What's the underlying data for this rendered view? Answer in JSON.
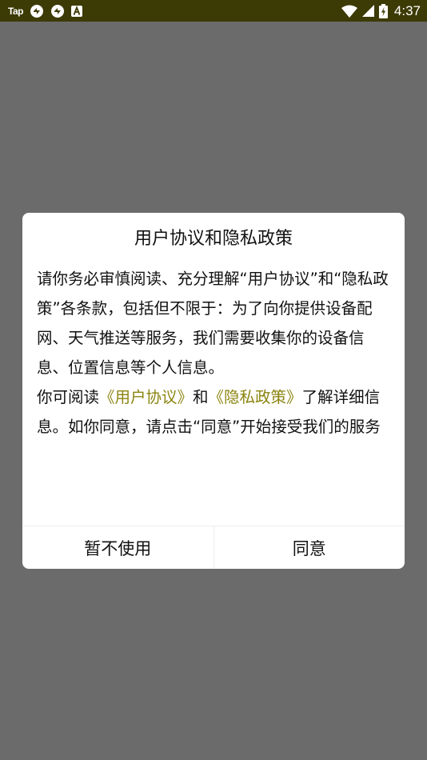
{
  "status_bar": {
    "app_label": "Tap",
    "time": "4:37",
    "icons": [
      "tap-app-icon",
      "sync-icon",
      "sync-icon",
      "a-app-icon",
      "wifi-icon",
      "signal-icon",
      "battery-charging-icon"
    ],
    "bg_color": "#3c3a05"
  },
  "dialog": {
    "title": "用户协议和隐私政策",
    "paragraph1": "请你务必审慎阅读、充分理解“用户协议”和“隐私政策”各条款，包括但不限于：为了向你提供设备配网、天气推送等服务，我们需要收集你的设备信息、位置信息等个人信息。",
    "p2_prefix": "你可阅读",
    "p2_link1": "《用户协议》",
    "p2_middle": "和",
    "p2_link2": "《隐私政策》",
    "p2_suffix": "了解详细信息。如你同意，请点击“同意”开始接受我们的服务",
    "decline_label": "暂不使用",
    "agree_label": "同意",
    "link_color": "#8b8410"
  }
}
